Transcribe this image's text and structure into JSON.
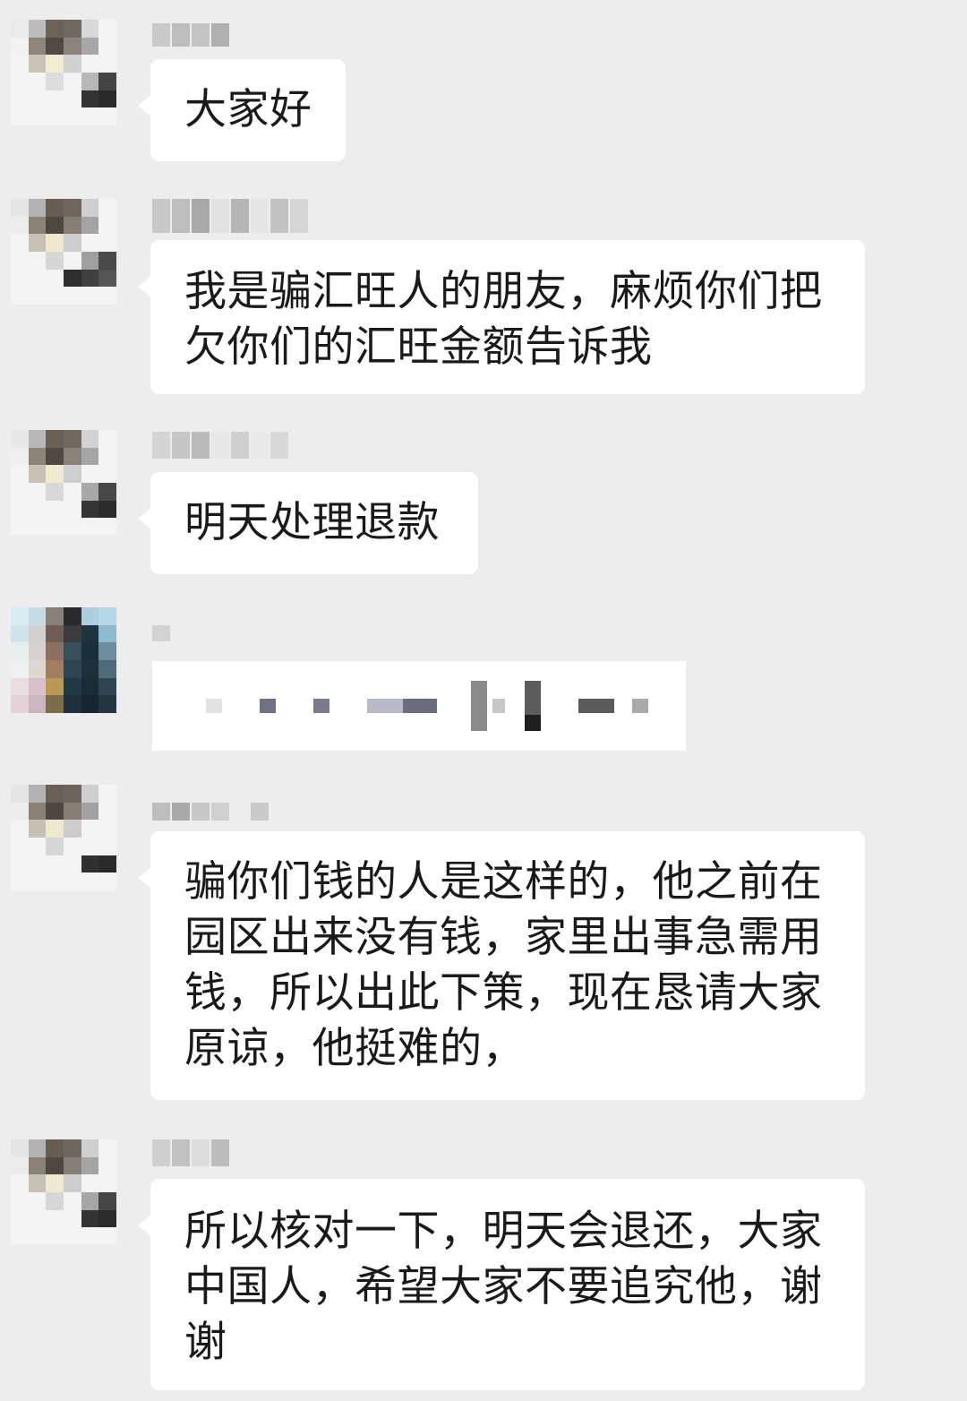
{
  "chat": {
    "messages": [
      {
        "text": "大家好"
      },
      {
        "text": "我是骗汇旺人的朋友，麻烦你们把\n欠你们的汇旺金额告诉我"
      },
      {
        "text": "明天处理退款"
      },
      {
        "text": ""
      },
      {
        "text": "骗你们钱的人是这样的，他之前在\n园区出来没有钱，家里出事急需用\n钱，所以出此下策，现在恳请大家\n原谅，他挺难的，"
      },
      {
        "text": "所以核对一下，明天会退还，大家\n中国人，希望大家不要追究他，谢\n谢"
      }
    ]
  },
  "colors": {
    "background": "#ededed",
    "bubble": "#ffffff",
    "text": "#1a1a1a"
  }
}
